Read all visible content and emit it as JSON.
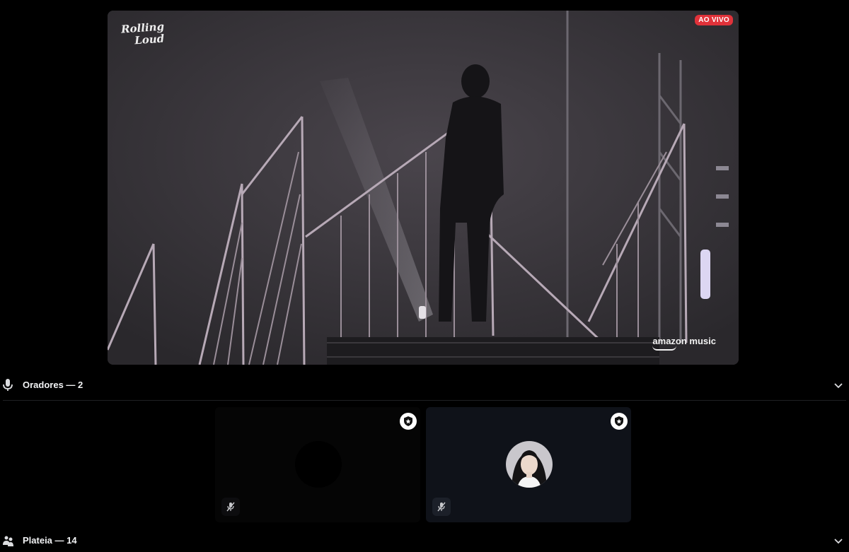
{
  "stream": {
    "live_badge": "AO VIVO",
    "brand_logo_line1": "Rolling",
    "brand_logo_line2": "Loud",
    "sponsor": "amazon music"
  },
  "speakers_section": {
    "title": "Oradores — 2",
    "icon": "microphone-icon",
    "expanded": true
  },
  "speakers": [
    {
      "role_icon": "host-badge-icon",
      "muted": true,
      "avatar": "dark-avatar"
    },
    {
      "role_icon": "host-badge-icon",
      "muted": true,
      "avatar": "profile-photo"
    }
  ],
  "audience_section": {
    "title": "Plateia — 14",
    "icon": "audience-icon"
  },
  "colors": {
    "live_red": "#e0323a",
    "background": "#000000",
    "tile_dark": "#0f1219"
  }
}
